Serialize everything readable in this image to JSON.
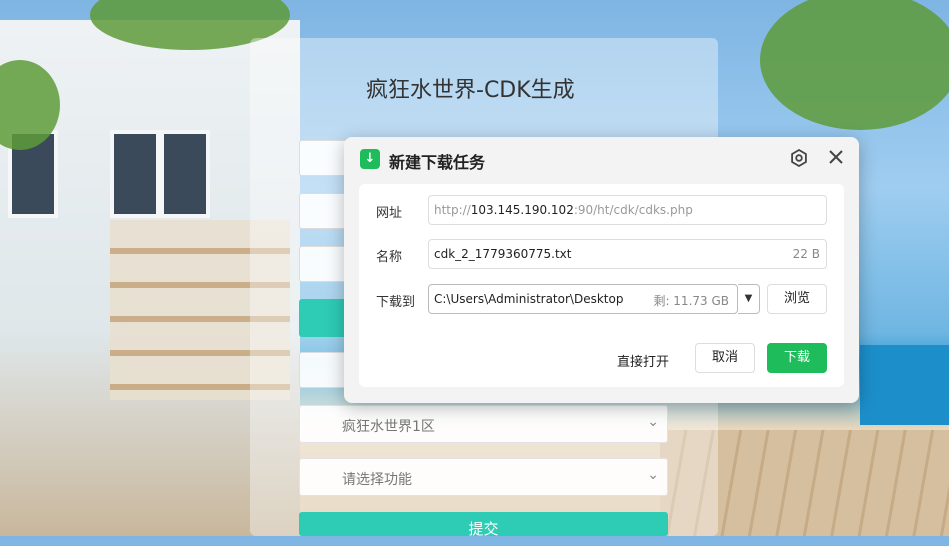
{
  "page": {
    "title": "疯狂水世界-CDK生成",
    "server_select": "疯狂水世界1区",
    "function_select": "请选择功能",
    "submit_label": "提交"
  },
  "dialog": {
    "title": "新建下载任务",
    "url_label": "网址",
    "url_prefix": "http://",
    "url_host": "103.145.190.102",
    "url_rest": ":90/ht/cdk/cdks.php",
    "name_label": "名称",
    "file_name": "cdk_2_1779360775.txt",
    "file_size": "22 B",
    "save_label": "下载到",
    "save_path": "C:\\Users\\Administrator\\Desktop",
    "free_space": "剩: 11.73 GB",
    "browse_label": "浏览",
    "open_direct_label": "直接打开",
    "cancel_label": "取消",
    "download_label": "下载"
  },
  "colors": {
    "accent_green": "#1ebc5b",
    "teal": "#2ecbb5"
  },
  "icons": [
    "download-app-icon",
    "gear-icon",
    "close-icon",
    "chevron-down-icon"
  ]
}
